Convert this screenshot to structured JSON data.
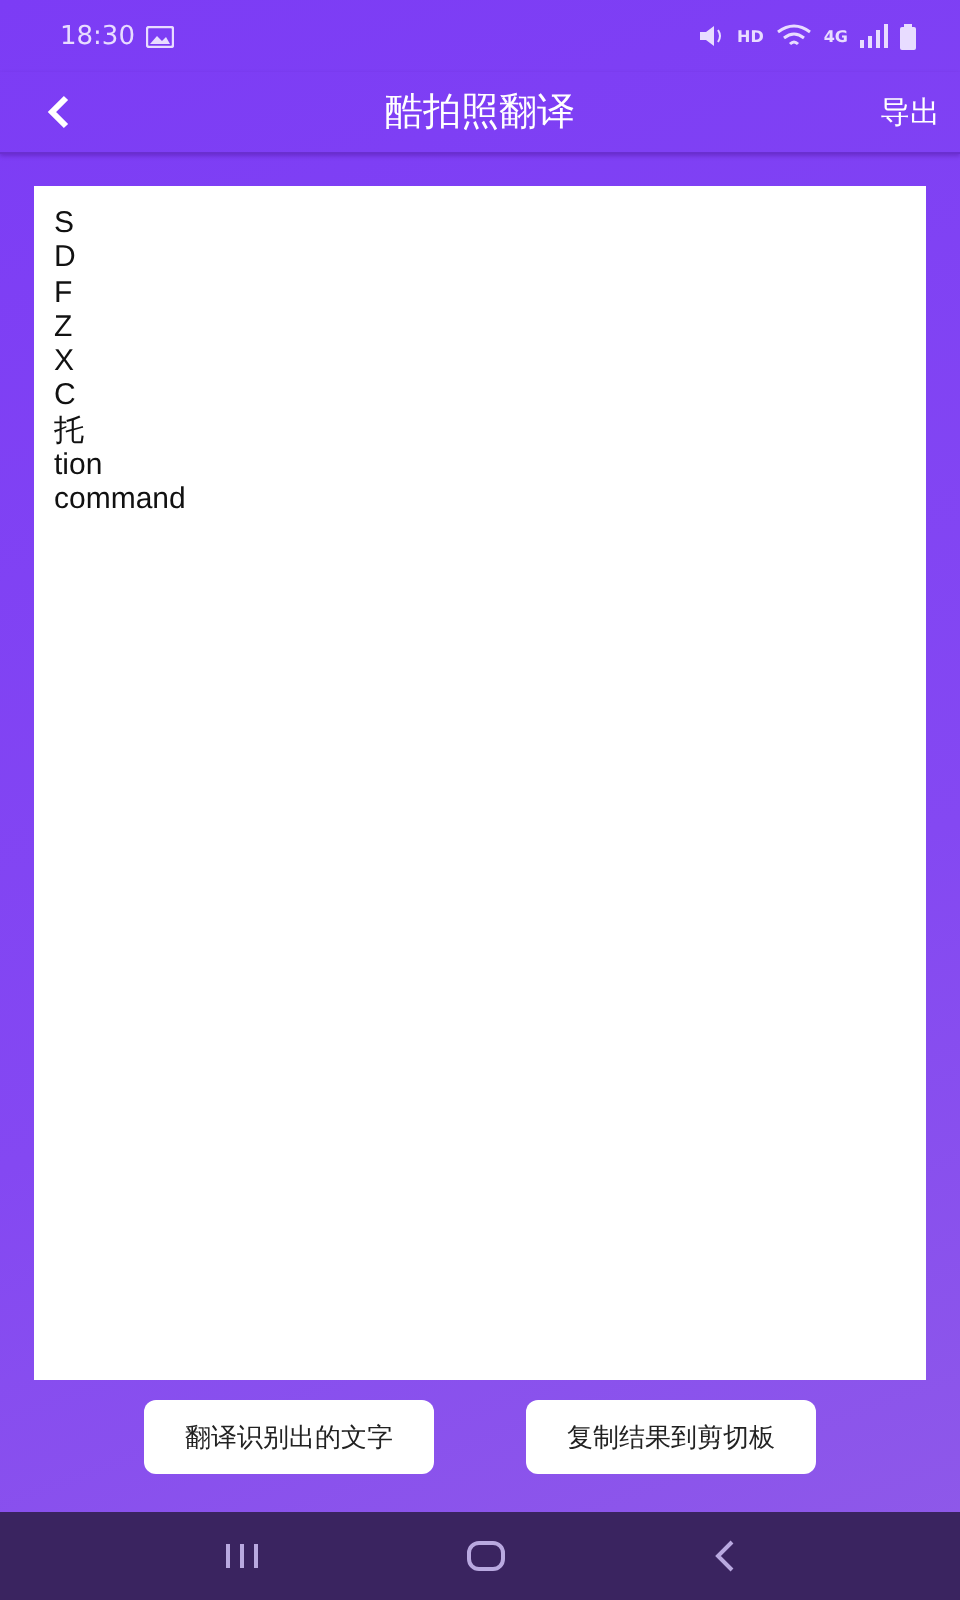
{
  "status_bar": {
    "time": "18:30",
    "hd": "HD",
    "network": "4G"
  },
  "header": {
    "title": "酷拍照翻译",
    "action": "导出"
  },
  "result_lines": [
    "S",
    "D",
    "F",
    "Z",
    "X",
    "C",
    "托",
    "tion",
    "command"
  ],
  "buttons": [
    "翻译识别出的文字",
    "复制结果到剪切板"
  ]
}
